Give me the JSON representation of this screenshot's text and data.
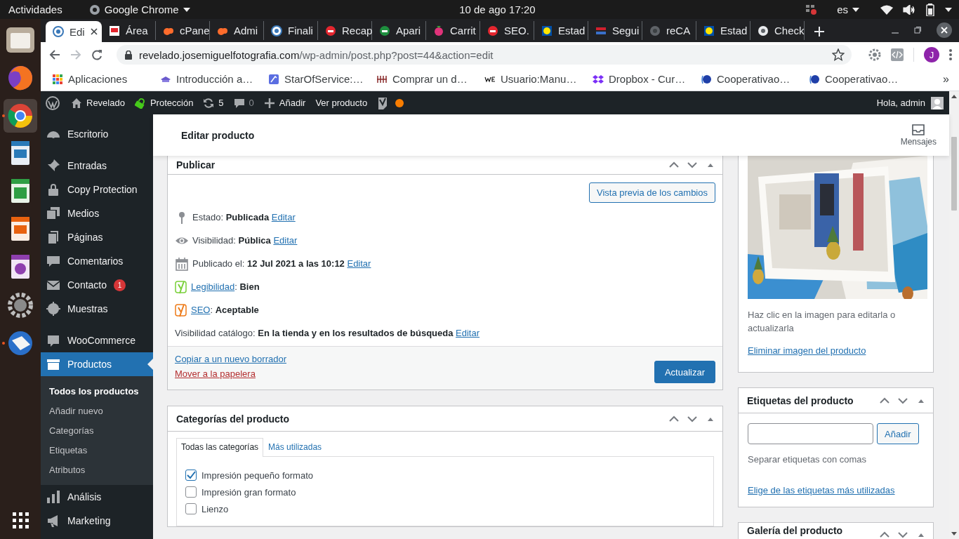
{
  "system_bar": {
    "activities": "Actividades",
    "app": "Google Chrome",
    "clock": "10 de ago  17:20",
    "language": "es"
  },
  "dock": [
    {
      "selected": false,
      "running": false
    },
    {
      "selected": false,
      "running": false
    },
    {
      "selected": true,
      "running": true
    },
    {
      "selected": false,
      "running": false
    },
    {
      "selected": false,
      "running": false
    },
    {
      "selected": false,
      "running": false
    },
    {
      "selected": false,
      "running": false
    },
    {
      "selected": false,
      "running": false
    },
    {
      "selected": false,
      "running": true
    },
    {
      "selected": false,
      "running": false
    }
  ],
  "browser": {
    "tabs": [
      {
        "title": "Edi",
        "selected": true
      },
      {
        "title": "Área",
        "selected": false
      },
      {
        "title": "cPane",
        "selected": false
      },
      {
        "title": "Admi",
        "selected": false
      },
      {
        "title": "Finali",
        "selected": false
      },
      {
        "title": "Recap",
        "selected": false
      },
      {
        "title": "Apari",
        "selected": false
      },
      {
        "title": "Carrit",
        "selected": false
      },
      {
        "title": "SEO.",
        "selected": false
      },
      {
        "title": "Estad",
        "selected": false
      },
      {
        "title": "Segui",
        "selected": false
      },
      {
        "title": "reCA",
        "selected": false
      },
      {
        "title": "Estad",
        "selected": false
      },
      {
        "title": "Check",
        "selected": false
      }
    ],
    "url": {
      "host": "revelado.josemiguelfotografia.com",
      "path": "/wp-admin/post.php?post=44&action=edit"
    },
    "profile": "J",
    "bookmarks": [
      "Aplicaciones",
      "Introducción a…",
      "StarOfService:…",
      "Comprar un d…",
      "Usuario:Manu…",
      "Dropbox - Cur…",
      "Cooperativao…",
      "Cooperativao…"
    ],
    "more_bookmarks": "»"
  },
  "admin_bar": {
    "items": [
      "Revelado",
      "Protección",
      "5",
      "0",
      "Añadir",
      "Ver producto"
    ],
    "greeting": "Hola, admin"
  },
  "sidebar": {
    "groups": [
      {
        "items": [
          {
            "label": "Escritorio",
            "selected": false
          }
        ]
      },
      {
        "items": [
          {
            "label": "Entradas",
            "selected": false
          },
          {
            "label": "Copy Protection",
            "selected": false
          },
          {
            "label": "Medios",
            "selected": false
          },
          {
            "label": "Páginas",
            "selected": false
          },
          {
            "label": "Comentarios",
            "selected": false
          },
          {
            "label": "Contacto",
            "selected": false,
            "badge": "1"
          },
          {
            "label": "Muestras",
            "selected": false
          }
        ]
      },
      {
        "items": [
          {
            "label": "WooCommerce",
            "selected": false
          },
          {
            "label": "Productos",
            "selected": true,
            "children": [
              {
                "label": "Todos los productos",
                "selected": true
              },
              {
                "label": "Añadir nuevo",
                "selected": false
              },
              {
                "label": "Categorías",
                "selected": false
              },
              {
                "label": "Etiquetas",
                "selected": false
              },
              {
                "label": "Atributos",
                "selected": false
              }
            ]
          },
          {
            "label": "Análisis",
            "selected": false
          },
          {
            "label": "Marketing",
            "selected": false
          }
        ]
      }
    ]
  },
  "page": {
    "title": "Editar producto",
    "messages": "Mensajes"
  },
  "publish_box": {
    "title": "Publicar",
    "preview_button": "Vista previa de los cambios",
    "rows": [
      {
        "kind": "meta",
        "label": "Estado:",
        "value": "Publicada",
        "action": "Editar"
      },
      {
        "kind": "meta",
        "label": "Visibilidad:",
        "value": "Pública",
        "action": "Editar"
      },
      {
        "kind": "meta",
        "label": "Publicado el:",
        "value": "12 Jul 2021 a las 10:12",
        "action": "Editar"
      },
      {
        "kind": "score",
        "link": "Legibilidad",
        "label": ":",
        "value": "Bien",
        "color": "#7ad03a"
      },
      {
        "kind": "score",
        "link": "SEO",
        "label": ":",
        "value": "Aceptable",
        "color": "#ee7c1b"
      },
      {
        "kind": "meta",
        "label": "Visibilidad catálogo:",
        "value": "En la tienda y en los resultados de búsqueda",
        "action": "Editar"
      }
    ],
    "copy_link": "Copiar a un nuevo borrador",
    "trash_link": "Mover a la papelera",
    "update_button": "Actualizar"
  },
  "categories_box": {
    "title": "Categorías del producto",
    "tabs": [
      {
        "label": "Todas las categorías",
        "selected": true
      },
      {
        "label": "Más utilizadas",
        "selected": false
      }
    ],
    "items": [
      {
        "label": "Impresión pequeño formato",
        "checked": true
      },
      {
        "label": "Impresión gran formato",
        "checked": false
      },
      {
        "label": "Lienzo",
        "checked": false
      }
    ]
  },
  "image_box": {
    "kind": "picture",
    "caption": "Haz clic en la imagen para editarla o actualizarla",
    "remove_link": "Eliminar imagen del producto"
  },
  "tags_box": {
    "title": "Etiquetas del producto",
    "add_button": "Añadir",
    "hint": "Separar etiquetas con comas",
    "popular_link": "Elige de las etiquetas más utilizadas"
  },
  "gallery_box": {
    "title": "Galería del producto"
  }
}
